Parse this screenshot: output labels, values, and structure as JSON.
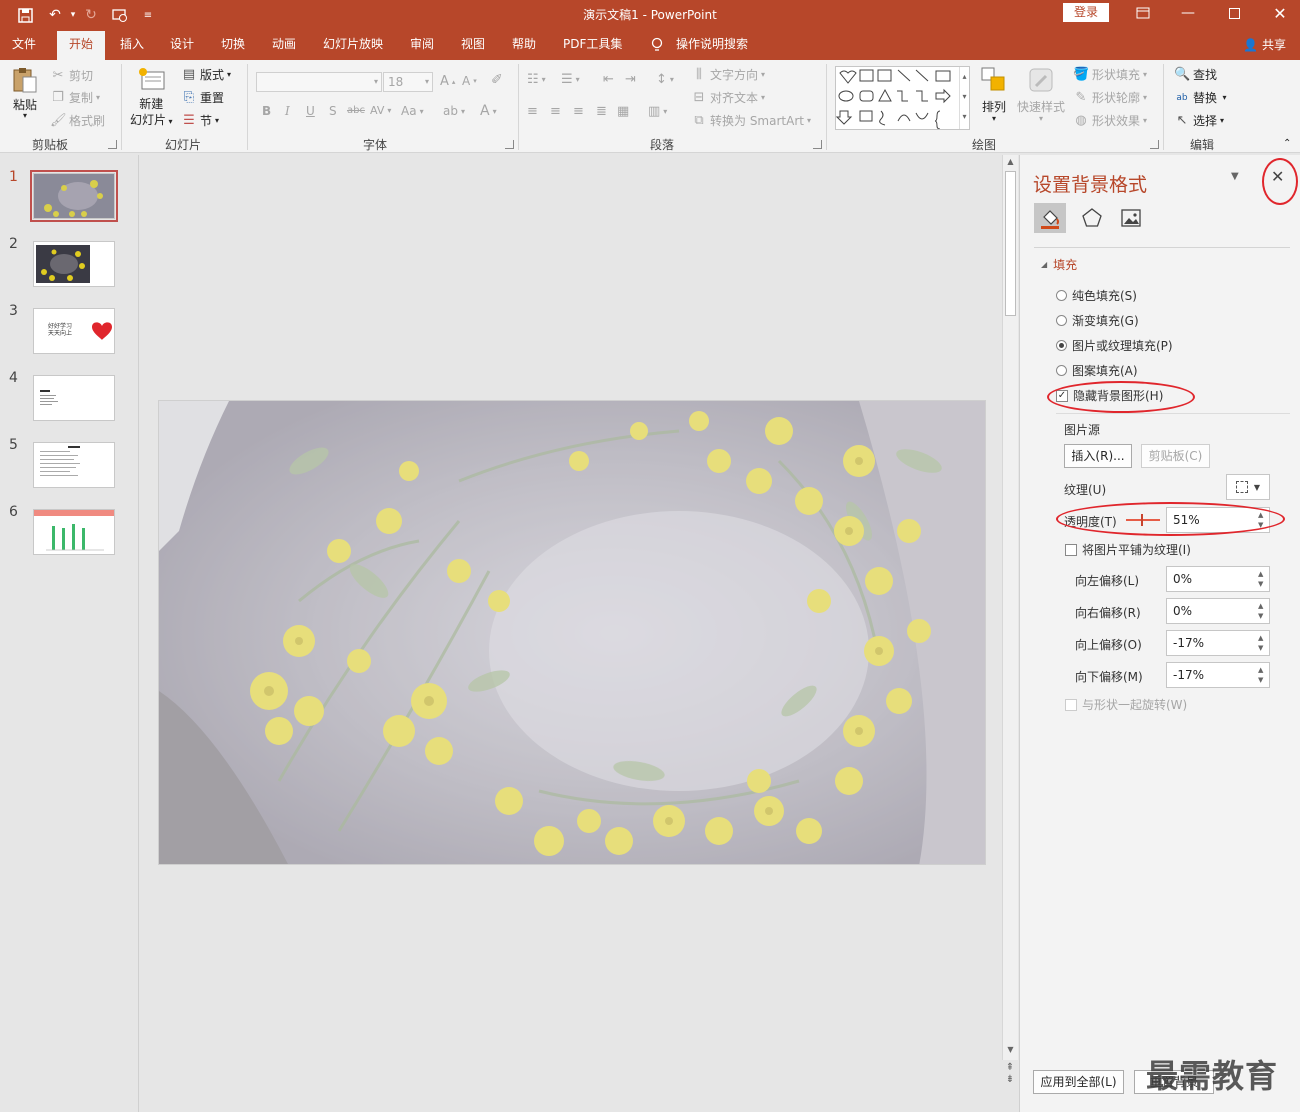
{
  "window": {
    "title": "演示文稿1  -  PowerPoint",
    "login_label": "登录"
  },
  "tabs": [
    {
      "label": "文件"
    },
    {
      "label": "开始"
    },
    {
      "label": "插入"
    },
    {
      "label": "设计"
    },
    {
      "label": "切换"
    },
    {
      "label": "动画"
    },
    {
      "label": "幻灯片放映"
    },
    {
      "label": "审阅"
    },
    {
      "label": "视图"
    },
    {
      "label": "帮助"
    },
    {
      "label": "PDF工具集"
    },
    {
      "label": "操作说明搜索"
    }
  ],
  "share_label": "共享",
  "ribbon": {
    "clipboard": {
      "paste": "粘贴",
      "cut": "剪切",
      "copy": "复制",
      "format_painter": "格式刷",
      "group": "剪贴板"
    },
    "slides": {
      "new_slide": "新建",
      "new_slide2": "幻灯片",
      "layout": "版式",
      "reset": "重置",
      "section": "节",
      "group": "幻灯片"
    },
    "font": {
      "size": "18",
      "group": "字体",
      "bold": "B",
      "italic": "I",
      "underline": "U",
      "shadow": "S",
      "strike": "abc",
      "spacing": "AV",
      "case": "Aa"
    },
    "paragraph": {
      "text_direction": "文字方向",
      "align_text": "对齐文本",
      "smartart": "转换为 SmartArt",
      "group": "段落"
    },
    "drawing": {
      "arrange": "排列",
      "quick_styles": "快速样式",
      "shape_fill": "形状填充",
      "shape_outline": "形状轮廓",
      "shape_effects": "形状效果",
      "group": "绘图"
    },
    "editing": {
      "find": "查找",
      "replace": "替换",
      "select": "选择",
      "group": "编辑"
    }
  },
  "slides": [
    {
      "num": "1",
      "text": ""
    },
    {
      "num": "2",
      "text": ""
    },
    {
      "num": "3",
      "text": "好好学习\n天天向上"
    },
    {
      "num": "4",
      "text": ""
    },
    {
      "num": "5",
      "text": ""
    },
    {
      "num": "6",
      "text": ""
    }
  ],
  "pane": {
    "title": "设置背景格式",
    "section_fill": "填充",
    "solid_fill": "纯色填充(S)",
    "gradient_fill": "渐变填充(G)",
    "picture_fill": "图片或纹理填充(P)",
    "pattern_fill": "图案填充(A)",
    "hide_bg": "隐藏背景图形(H)",
    "picture_source": "图片源",
    "insert_btn": "插入(R)...",
    "clipboard_btn": "剪贴板(C)",
    "texture": "纹理(U)",
    "transparency": "透明度(T)",
    "transparency_value": "51%",
    "tile": "将图片平铺为纹理(I)",
    "offset_left": "向左偏移(L)",
    "offset_left_value": "0%",
    "offset_right": "向右偏移(R)",
    "offset_right_value": "0%",
    "offset_top": "向上偏移(O)",
    "offset_top_value": "-17%",
    "offset_bottom": "向下偏移(M)",
    "offset_bottom_value": "-17%",
    "rotate_with_shape": "与形状一起旋转(W)",
    "apply_all": "应用到全部(L)",
    "reset_bg": "重置背景"
  },
  "watermark": "最需教育",
  "colors": {
    "accent": "#b7472a",
    "highlight_ring": "#e0262c"
  }
}
